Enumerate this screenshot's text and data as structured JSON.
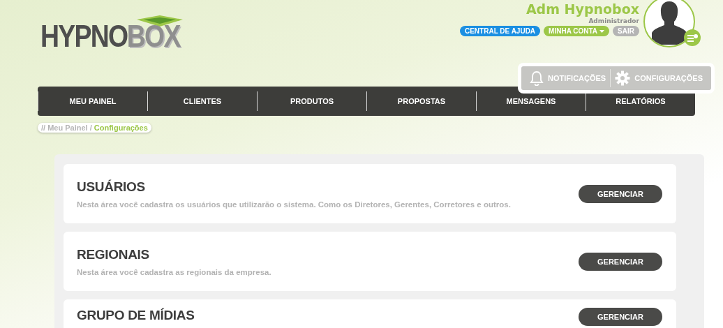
{
  "logo": {
    "text_1": "HYPNO",
    "text_2": "BOX"
  },
  "user": {
    "name": "Adm Hypnobox",
    "role": "Administrador"
  },
  "user_links": [
    {
      "label": "CENTRAL DE AJUDA",
      "color": "#1b8fe2",
      "caret": false
    },
    {
      "label": "MINHA CONTA",
      "color": "#9cc748",
      "caret": true
    },
    {
      "label": "SAIR",
      "color": "#b4b4b4",
      "caret": false
    }
  ],
  "toolbar": [
    {
      "kind": "bell",
      "label": "NOTIFICAÇÕES"
    },
    {
      "kind": "gear",
      "label": "CONFIGURAÇÕES"
    }
  ],
  "nav": [
    "MEU PAINEL",
    "CLIENTES",
    "PRODUTOS",
    "PROPOSTAS",
    "MENSAGENS",
    "RELATÓRIOS"
  ],
  "breadcrumb": {
    "path": "// Meu Painel /",
    "current": "Configurações"
  },
  "sections": [
    {
      "title": "USUÁRIOS",
      "description": "Nesta área você cadastra os usuários que utilizarão o sistema. Como os Diretores, Gerentes, Corretores e outros.",
      "button": "GERENCIAR"
    },
    {
      "title": "REGIONAIS",
      "description": "Nesta área você cadastra as regionais da empresa.",
      "button": "GERENCIAR"
    },
    {
      "title": "GRUPO DE MÍDIAS",
      "button": "GERENCIAR"
    }
  ]
}
